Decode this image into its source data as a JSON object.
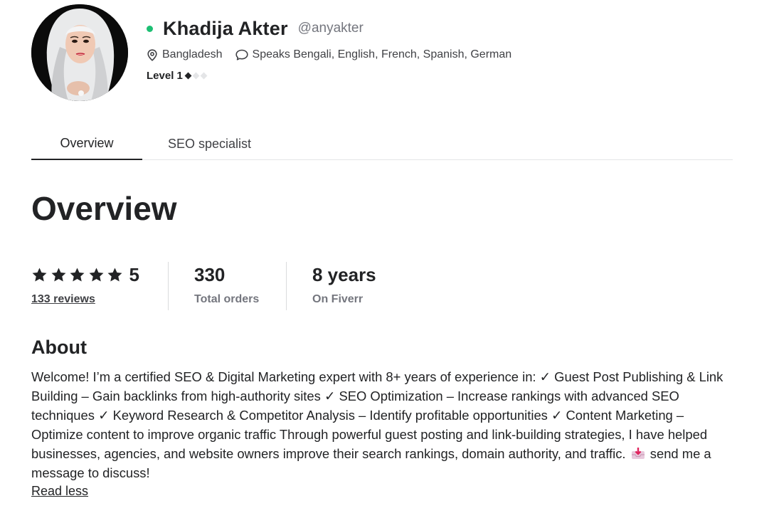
{
  "seller": {
    "name": "Khadija Akter",
    "handle": "@anyakter",
    "online": true,
    "location": "Bangladesh",
    "languages": "Speaks Bengali, English, French, Spanish, German",
    "level_label": "Level 1",
    "level_value": 1,
    "level_max": 3
  },
  "tabs": [
    {
      "label": "Overview",
      "active": true
    },
    {
      "label": "SEO specialist",
      "active": false
    }
  ],
  "overview": {
    "title": "Overview",
    "rating": {
      "stars": 5,
      "value": "5",
      "reviews_label": "133 reviews"
    },
    "orders": {
      "value": "330",
      "label": "Total orders"
    },
    "tenure": {
      "value": "8 years",
      "label": "On Fiverr"
    }
  },
  "about": {
    "title": "About",
    "text_before_emoji": "Welcome! I’m a certified SEO & Digital Marketing expert with 8+ years of experience in: ✓ Guest Post Publishing & Link Building – Gain backlinks from high-authority sites ✓ SEO Optimization – Increase rankings with advanced SEO techniques ✓ Keyword Research & Competitor Analysis – Identify profitable opportunities ✓ Content Marketing – Optimize content to improve organic traffic Through powerful guest posting and link-building strategies, I have helped businesses, agencies, and website owners improve their search rankings, domain authority, and traffic.",
    "text_after_emoji": "send me a message to discuss!",
    "emoji_icon": "inbox-tray-icon",
    "read_less_label": "Read less"
  },
  "colors": {
    "online": "#1dbf73",
    "text": "#222325",
    "muted": "#74767e",
    "divider": "#e4e5e7"
  },
  "icons": [
    "avatar-photo",
    "location-pin-icon",
    "speech-bubble-icon",
    "level-diamond-icon",
    "star-icon",
    "inbox-tray-icon"
  ]
}
